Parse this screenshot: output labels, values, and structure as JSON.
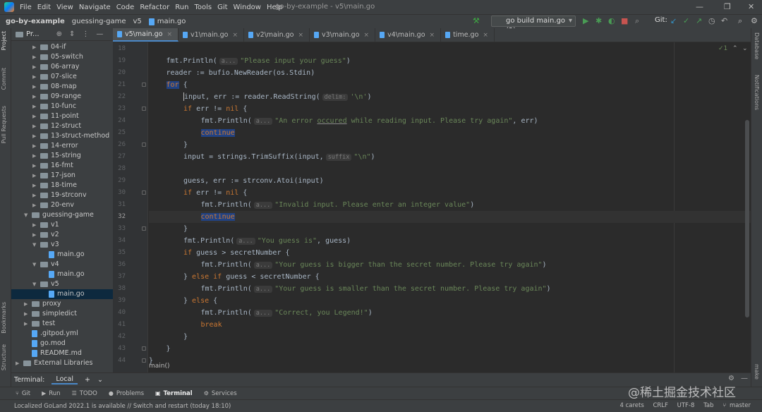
{
  "window": {
    "menu": [
      "File",
      "Edit",
      "View",
      "Navigate",
      "Code",
      "Refactor",
      "Run",
      "Tools",
      "Git",
      "Window",
      "Help"
    ],
    "title": "go-by-example - v5\\main.go",
    "controls": [
      "—",
      "❐",
      "✕"
    ]
  },
  "nav": {
    "crumbs": [
      "go-by-example",
      "guessing-game",
      "v5",
      "main.go"
    ],
    "run_config": "go build main.go (2)",
    "git_label": "Git:"
  },
  "project": {
    "header": "Pr...",
    "items": [
      {
        "label": "04-if",
        "type": "folder",
        "indent": 0
      },
      {
        "label": "05-switch",
        "type": "folder",
        "indent": 0
      },
      {
        "label": "06-array",
        "type": "folder",
        "indent": 0
      },
      {
        "label": "07-slice",
        "type": "folder",
        "indent": 0
      },
      {
        "label": "08-map",
        "type": "folder",
        "indent": 0
      },
      {
        "label": "09-range",
        "type": "folder",
        "indent": 0
      },
      {
        "label": "10-func",
        "type": "folder",
        "indent": 0
      },
      {
        "label": "11-point",
        "type": "folder",
        "indent": 0
      },
      {
        "label": "12-struct",
        "type": "folder",
        "indent": 0
      },
      {
        "label": "13-struct-method",
        "type": "folder",
        "indent": 0
      },
      {
        "label": "14-error",
        "type": "folder",
        "indent": 0
      },
      {
        "label": "15-string",
        "type": "folder",
        "indent": 0
      },
      {
        "label": "16-fmt",
        "type": "folder",
        "indent": 0
      },
      {
        "label": "17-json",
        "type": "folder",
        "indent": 0
      },
      {
        "label": "18-time",
        "type": "folder",
        "indent": 0
      },
      {
        "label": "19-strconv",
        "type": "folder",
        "indent": 0
      },
      {
        "label": "20-env",
        "type": "folder",
        "indent": 0
      },
      {
        "label": "guessing-game",
        "type": "folder-open",
        "indent": -1
      },
      {
        "label": "v1",
        "type": "folder",
        "indent": 0
      },
      {
        "label": "v2",
        "type": "folder",
        "indent": 0
      },
      {
        "label": "v3",
        "type": "folder-open",
        "indent": 0
      },
      {
        "label": "main.go",
        "type": "file",
        "indent": 1
      },
      {
        "label": "v4",
        "type": "folder-open",
        "indent": 0
      },
      {
        "label": "main.go",
        "type": "file",
        "indent": 1
      },
      {
        "label": "v5",
        "type": "folder-open",
        "indent": 0
      },
      {
        "label": "main.go",
        "type": "file",
        "indent": 1,
        "selected": true
      },
      {
        "label": "proxy",
        "type": "folder",
        "indent": -1
      },
      {
        "label": "simpledict",
        "type": "folder",
        "indent": -1
      },
      {
        "label": "test",
        "type": "folder",
        "indent": -1
      },
      {
        "label": ".gitpod.yml",
        "type": "file",
        "indent": -1
      },
      {
        "label": "go.mod",
        "type": "file",
        "indent": -1
      },
      {
        "label": "README.md",
        "type": "file",
        "indent": -1
      },
      {
        "label": "External Libraries",
        "type": "lib",
        "indent": -2
      }
    ]
  },
  "tabs": [
    {
      "label": "v5\\main.go",
      "active": true
    },
    {
      "label": "v1\\main.go",
      "active": false
    },
    {
      "label": "v2\\main.go",
      "active": false
    },
    {
      "label": "v3\\main.go",
      "active": false
    },
    {
      "label": "v4\\main.go",
      "active": false
    },
    {
      "label": "time.go",
      "active": false
    }
  ],
  "editor": {
    "current_line": 32,
    "inspection": "✓1",
    "breadcrumb": "main()",
    "hints": {
      "a": "a...",
      "delim": "delim:",
      "suffix": "suffix"
    },
    "lines": [
      {
        "n": 18,
        "text": ""
      },
      {
        "n": 19,
        "indent": 1,
        "pre": "fmt.Println(",
        "hint": "a",
        "str": "\"Please input your guess\"",
        "post": ")"
      },
      {
        "n": 20,
        "indent": 1,
        "pre": "reader := bufio.NewReader(os.Stdin)"
      },
      {
        "n": 21,
        "indent": 1,
        "kw": "for",
        "post": " {",
        "hl": true
      },
      {
        "n": 22,
        "indent": 2,
        "pre": "input, err := reader.ReadString(",
        "hint": "delim",
        "str": "'\\n'",
        "post": ")"
      },
      {
        "n": 23,
        "indent": 2,
        "kw": "if",
        "pre": " err != ",
        "kw2": "nil",
        "post": " {"
      },
      {
        "n": 24,
        "indent": 3,
        "pre": "fmt.Println(",
        "hint": "a",
        "str": "\"An error occured while reading input. Please try again\"",
        "post": ", err)"
      },
      {
        "n": 25,
        "indent": 3,
        "kw": "continue",
        "hl": true
      },
      {
        "n": 26,
        "indent": 2,
        "post": "}"
      },
      {
        "n": 27,
        "indent": 2,
        "pre": "input = strings.TrimSuffix(input,",
        "hint": "suffix",
        "str": "\"\\n\"",
        "post": ")"
      },
      {
        "n": 28,
        "text": ""
      },
      {
        "n": 29,
        "indent": 2,
        "pre": "guess, err := strconv.Atoi(input)"
      },
      {
        "n": 30,
        "indent": 2,
        "kw": "if",
        "pre": " err != ",
        "kw2": "nil",
        "post": " {"
      },
      {
        "n": 31,
        "indent": 3,
        "pre": "fmt.Println(",
        "hint": "a",
        "str": "\"Invalid input. Please enter an integer value\"",
        "post": ")"
      },
      {
        "n": 32,
        "indent": 3,
        "kw": "continue",
        "hl": true
      },
      {
        "n": 33,
        "indent": 2,
        "post": "}"
      },
      {
        "n": 34,
        "indent": 2,
        "pre": "fmt.Println(",
        "hint": "a",
        "str": "\"You guess is\"",
        "post": ", guess)"
      },
      {
        "n": 35,
        "indent": 2,
        "kw": "if",
        "pre": " guess > secretNumber {"
      },
      {
        "n": 36,
        "indent": 3,
        "pre": "fmt.Println(",
        "hint": "a",
        "str": "\"Your guess is bigger than the secret number. Please try again\"",
        "post": ")"
      },
      {
        "n": 37,
        "indent": 2,
        "pre": "} ",
        "kw": "else if",
        "post": " guess < secretNumber {"
      },
      {
        "n": 38,
        "indent": 3,
        "pre": "fmt.Println(",
        "hint": "a",
        "str": "\"Your guess is smaller than the secret number. Please try again\"",
        "post": ")"
      },
      {
        "n": 39,
        "indent": 2,
        "pre": "} ",
        "kw": "else",
        "post": " {"
      },
      {
        "n": 40,
        "indent": 3,
        "pre": "fmt.Println(",
        "hint": "a",
        "str": "\"Correct, you Legend!\"",
        "post": ")"
      },
      {
        "n": 41,
        "indent": 3,
        "kw": "break"
      },
      {
        "n": 42,
        "indent": 2,
        "post": "}"
      },
      {
        "n": 43,
        "indent": 1,
        "post": "}"
      },
      {
        "n": 44,
        "indent": 0,
        "post": "}"
      }
    ]
  },
  "terminal": {
    "label": "Terminal:",
    "tab": "Local",
    "add": "+",
    "chevron": "⌄"
  },
  "toolwindows": [
    {
      "label": "Git",
      "icon": "⑂"
    },
    {
      "label": "Run",
      "icon": "▶"
    },
    {
      "label": "TODO",
      "icon": "☰"
    },
    {
      "label": "Problems",
      "icon": "●"
    },
    {
      "label": "Terminal",
      "icon": "▣",
      "active": true
    },
    {
      "label": "Services",
      "icon": "⚙"
    }
  ],
  "status": {
    "message": "Localized GoLand 2022.1 is available // Switch and restart (today 18:10)",
    "carets": "4 carets",
    "line_sep": "CRLF",
    "encoding": "UTF-8",
    "indent": "Tab",
    "branch": "master"
  },
  "side_tabs": {
    "left": [
      "Project",
      "Commit",
      "Pull Requests",
      "Bookmarks",
      "Structure"
    ],
    "right": [
      "Database",
      "Notifications",
      "make"
    ]
  },
  "watermark": "@稀土掘金技术社区"
}
